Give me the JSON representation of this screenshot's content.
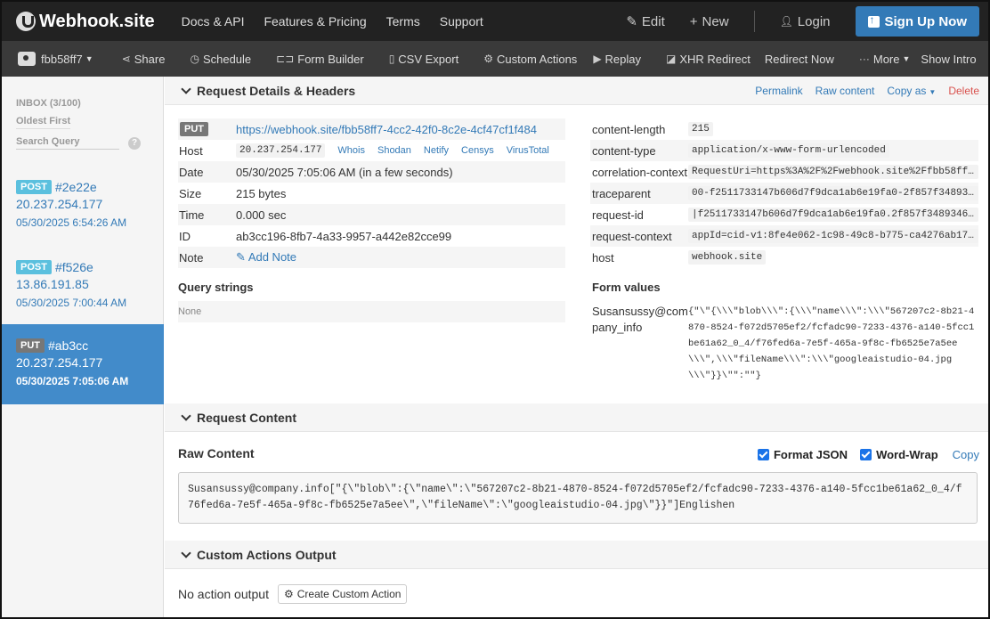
{
  "nav": {
    "brand": "Webhook.site",
    "links": [
      "Docs & API",
      "Features & Pricing",
      "Terms",
      "Support"
    ],
    "edit": "Edit",
    "new": "New",
    "login": "Login",
    "signup": "Sign Up Now"
  },
  "toolbar": {
    "token": "fbb58ff7",
    "share": "Share",
    "schedule": "Schedule",
    "form_builder": "Form Builder",
    "csv_export": "CSV Export",
    "custom_actions": "Custom Actions",
    "replay": "Replay",
    "xhr_redirect": "XHR Redirect",
    "redirect_now": "Redirect Now",
    "more": "More",
    "show_intro": "Show Intro"
  },
  "sidebar": {
    "inbox": "INBOX (3/100)",
    "oldest_first": "Oldest First",
    "search_placeholder": "Search Query",
    "requests": [
      {
        "method": "POST",
        "id": "#2e22e",
        "ip": "20.237.254.177",
        "time": "05/30/2025 6:54:26 AM"
      },
      {
        "method": "POST",
        "id": "#f526e",
        "ip": "13.86.191.85",
        "time": "05/30/2025 7:00:44 AM"
      },
      {
        "method": "PUT",
        "id": "#ab3cc",
        "ip": "20.237.254.177",
        "time": "05/30/2025 7:05:06 AM"
      }
    ]
  },
  "details": {
    "title": "Request Details & Headers",
    "permalink": "Permalink",
    "raw_content": "Raw content",
    "copy_as": "Copy as",
    "delete": "Delete",
    "method": "PUT",
    "url": "https://webhook.site/fbb58ff7-4cc2-42f0-8c2e-4cf47cf1f484",
    "host_label": "Host",
    "host_ip": "20.237.254.177",
    "host_links": [
      "Whois",
      "Shodan",
      "Netify",
      "Censys",
      "VirusTotal"
    ],
    "date_label": "Date",
    "date": "05/30/2025 7:05:06 AM (in a few seconds)",
    "size_label": "Size",
    "size": "215 bytes",
    "time_label": "Time",
    "time": "0.000 sec",
    "id_label": "ID",
    "id": "ab3cc196-8fb7-4a33-9957-a442e82cce99",
    "note_label": "Note",
    "add_note": "Add Note",
    "query_title": "Query strings",
    "query_none": "None",
    "headers": [
      {
        "k": "content-length",
        "v": "215"
      },
      {
        "k": "content-type",
        "v": "application/x-www-form-urlencoded"
      },
      {
        "k": "correlation-context",
        "v": "RequestUri=https%3A%2F%2Fwebhook.site%2Ffbb58ff7-4cc2-42f0-8c2e-4cf47cf1f484"
      },
      {
        "k": "traceparent",
        "v": "00-f2511733147b606d7f9dca1ab6e19fa0-2f857f34893460a1-00"
      },
      {
        "k": "request-id",
        "v": "|f2511733147b606d7f9dca1ab6e19fa0.2f857f34893460a1."
      },
      {
        "k": "request-context",
        "v": "appId=cid-v1:8fe4e062-1c98-49c8-b775-ca4276ab17f9"
      },
      {
        "k": "host",
        "v": "webhook.site"
      }
    ],
    "form_title": "Form values",
    "form_key": "Susansussy@company_info",
    "form_value": "{\"\\\"{\\\\\\\"blob\\\\\\\":{\\\\\\\"name\\\\\\\":\\\\\\\"567207c2-8b21-4870-8524-f072d5705ef2/fcfadc90-7233-4376-a140-5fcc1be61a62_0_4/f76fed6a-7e5f-465a-9f8c-fb6525e7a5ee\\\\\\\",\\\\\\\"fileName\\\\\\\":\\\\\\\"googleaistudio-04.jpg\\\\\\\"}}\\\"\":\"\"}"
  },
  "content": {
    "title": "Request Content",
    "raw_title": "Raw Content",
    "format_json": "Format JSON",
    "word_wrap": "Word-Wrap",
    "copy": "Copy",
    "raw": "Susansussy@company.info[\"{\\\"blob\\\":{\\\"name\\\":\\\"567207c2-8b21-4870-8524-f072d5705ef2/fcfadc90-7233-4376-a140-5fcc1be61a62_0_4/f76fed6a-7e5f-465a-9f8c-fb6525e7a5ee\\\",\\\"fileName\\\":\\\"googleaistudio-04.jpg\\\"}}\"]Englishen"
  },
  "actions": {
    "title": "Custom Actions Output",
    "no_output": "No action output",
    "create_button": "Create Custom Action"
  }
}
